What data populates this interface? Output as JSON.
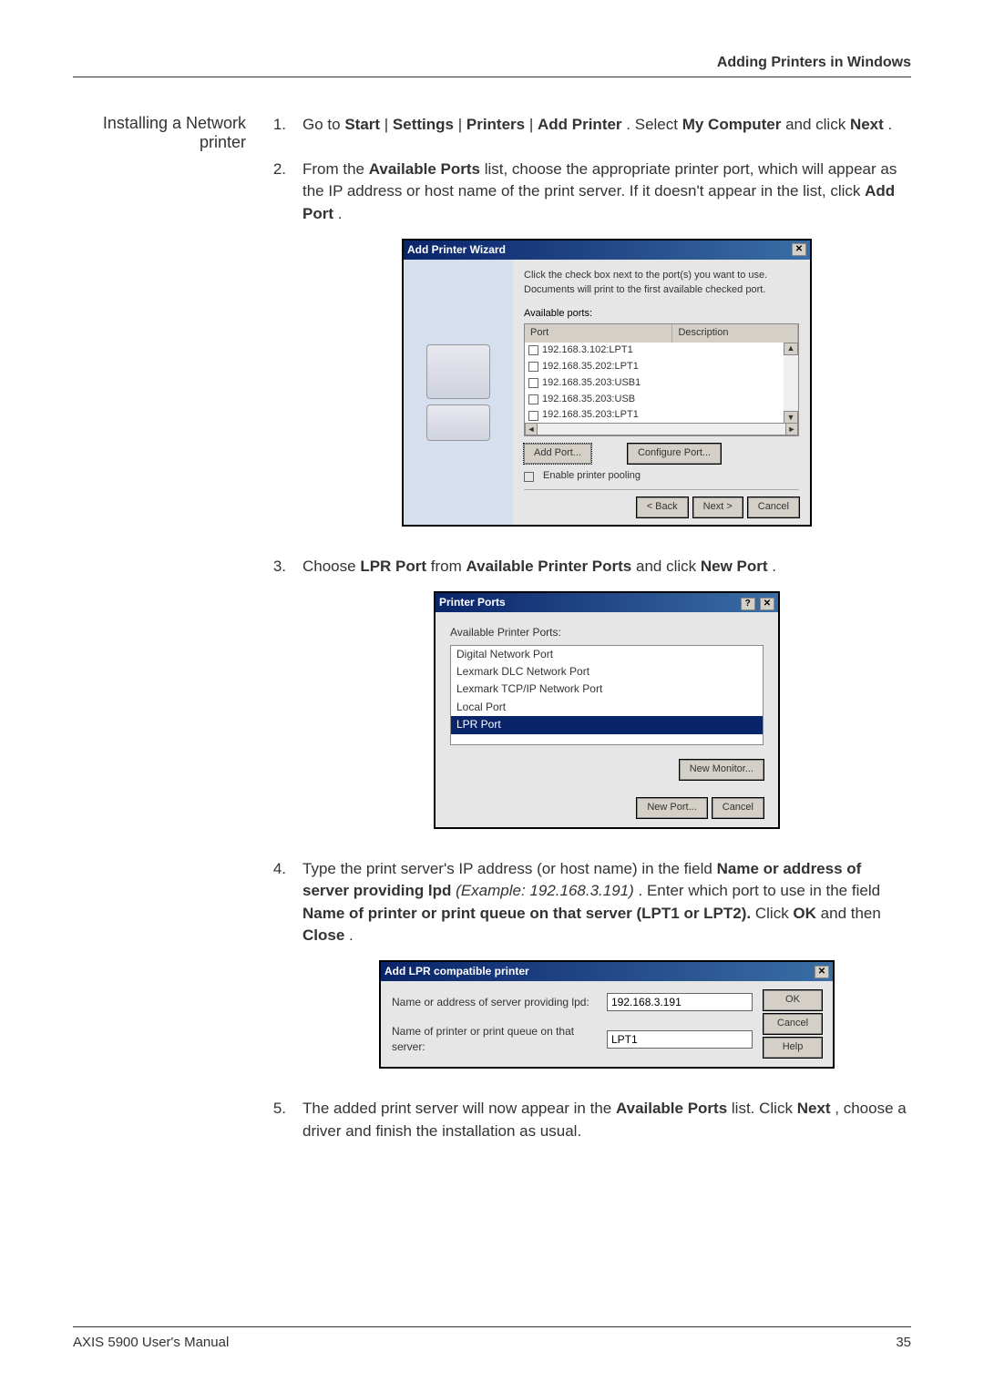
{
  "header": {
    "section_title": "Adding Printers in Windows"
  },
  "sidebar": {
    "heading_l1": "Installing a Network",
    "heading_l2": "printer"
  },
  "steps": {
    "s1": {
      "num": "1.",
      "pre": "Go to ",
      "path1": "Start",
      "sep": " | ",
      "path2": "Settings",
      "path3": "Printers",
      "path4": "Add Printer",
      "mid": ". Select ",
      "sel": "My Computer",
      "mid2": " and click ",
      "act": "Next",
      "end": "."
    },
    "s2": {
      "num": "2.",
      "pre": "From the ",
      "bold": "Available Ports",
      "post": " list, choose the appropriate printer port, which will appear as the IP address or host name of the print server. If it doesn't appear in the list, click ",
      "act": "Add Port",
      "end": "."
    },
    "s3": {
      "num": "3.",
      "pre": "Choose ",
      "b1": "LPR Port",
      "mid": " from ",
      "b2": "Available Printer Ports",
      "mid2": " and click ",
      "b3": "New Port",
      "end": "."
    },
    "s4": {
      "num": "4.",
      "pre": "Type the print server's IP address (or host name) in the field ",
      "b1": "Name or address of server providing lpd ",
      "ex": "(Example: 192.168.3.191)",
      "mid": ". Enter which port to use in the field ",
      "b2": "Name of printer or print queue on that server (LPT1 or LPT2).",
      "mid2": " Click ",
      "b3": "OK",
      "mid3": " and then ",
      "b4": "Close",
      "end": "."
    },
    "s5": {
      "num": "5.",
      "pre": "The added print server will now appear in the ",
      "b1": "Available Ports",
      "mid": " list. Click ",
      "b2": "Next",
      "end": ", choose a driver and finish the installation as usual."
    }
  },
  "dlg1": {
    "title": "Add Printer Wizard",
    "desc": "Click the check box next to the port(s) you want to use. Documents will print to the first available checked port.",
    "avail": "Available ports:",
    "col_port": "Port",
    "col_desc": "Description",
    "rows": [
      "192.168.3.102:LPT1",
      "192.168.35.202:LPT1",
      "192.168.35.203:USB1",
      "192.168.35.203:USB",
      "192.168.35.203:LPT1"
    ],
    "add_port": "Add Port...",
    "config_port": "Configure Port...",
    "pool": "Enable printer pooling",
    "back": "< Back",
    "next": "Next >",
    "cancel": "Cancel"
  },
  "dlg2": {
    "title": "Printer Ports",
    "label": "Available Printer Ports:",
    "opts": [
      "Digital Network Port",
      "Lexmark DLC Network Port",
      "Lexmark TCP/IP Network Port",
      "Local Port",
      "LPR Port"
    ],
    "new_monitor": "New Monitor...",
    "new_port": "New Port...",
    "cancel": "Cancel"
  },
  "dlg3": {
    "title": "Add LPR compatible printer",
    "lbl1": "Name or address of server providing lpd:",
    "val1": "192.168.3.191",
    "lbl2": "Name of printer or print queue on that server:",
    "val2": "LPT1",
    "ok": "OK",
    "cancel": "Cancel",
    "help": "Help"
  },
  "footer": {
    "left": "AXIS 5900 User's Manual",
    "right": "35"
  }
}
